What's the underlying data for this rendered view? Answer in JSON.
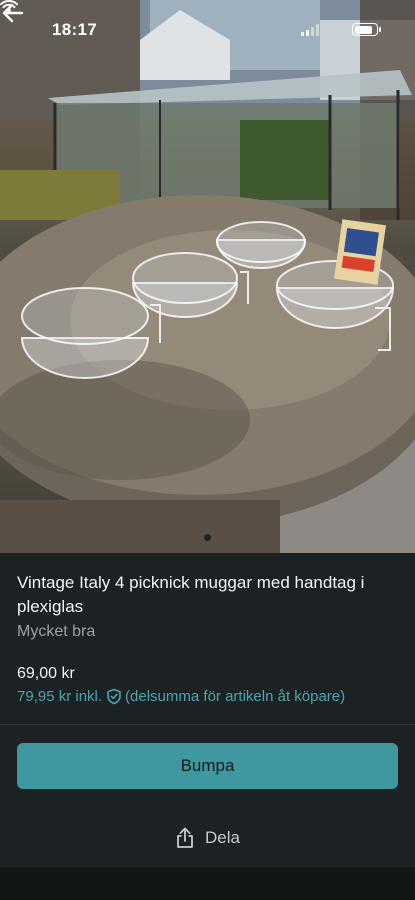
{
  "status_bar": {
    "time": "18:17"
  },
  "listing": {
    "title": "Vintage Italy 4 picknick muggar med handtag i plexiglas",
    "condition": "Mycket bra",
    "price": "69,00 kr",
    "price_incl": "79,95 kr inkl.",
    "protection_note": "(delsumma för artikeln åt köpare)"
  },
  "actions": {
    "bump_label": "Bumpa",
    "share_label": "Dela"
  },
  "gallery": {
    "total_images": 2,
    "active_index": 1
  },
  "colors": {
    "accent": "#3f979f",
    "accent_text": "#4ea3ad",
    "panel": "#1c2124"
  },
  "icons": {
    "back": "arrow-left-icon",
    "shield": "shield-check-icon",
    "share": "share-icon"
  }
}
